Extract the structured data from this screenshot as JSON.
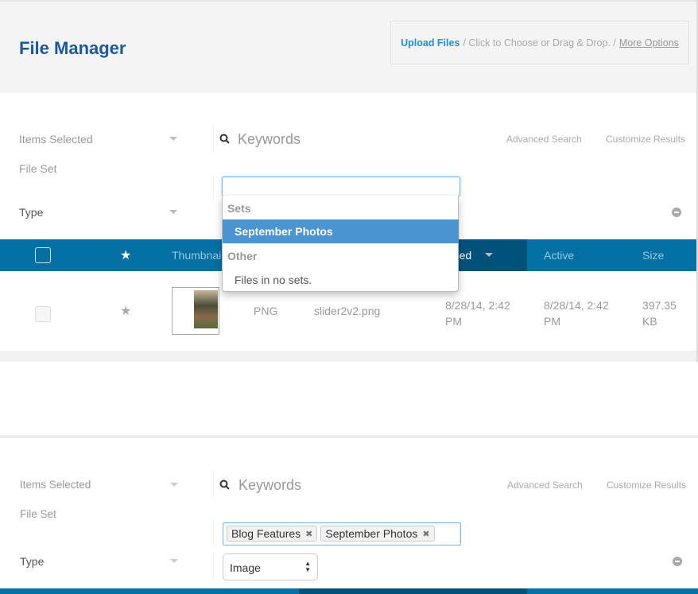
{
  "header": {
    "title": "File Manager",
    "upload": {
      "link": "Upload Files",
      "text": "/ Click to Choose or Drag & Drop. /",
      "more": "More Options"
    }
  },
  "panel1": {
    "filters": {
      "items_selected": "Items Selected",
      "file_set": "File Set",
      "type": "Type"
    },
    "search": {
      "placeholder": "Keywords",
      "advanced": "Advanced Search",
      "customize": "Customize Results"
    },
    "dropdown": {
      "group_sets": "Sets",
      "sets": [
        "September Photos"
      ],
      "group_other": "Other",
      "other": [
        "Files in no sets."
      ],
      "highlighted": "September Photos"
    },
    "columns": {
      "thumbnail": "Thumbnail",
      "date_added": "Date Added",
      "active": "Active",
      "size": "Size"
    },
    "rows": [
      {
        "type": "PNG",
        "name": "slider2v2.png",
        "added": "8/28/14, 2:42 PM",
        "active": "8/28/14, 2:42 PM",
        "size": "397.35 KB"
      }
    ]
  },
  "panel2": {
    "filters": {
      "items_selected": "Items Selected",
      "file_set": "File Set",
      "type": "Type"
    },
    "search": {
      "placeholder": "Keywords",
      "advanced": "Advanced Search",
      "customize": "Customize Results"
    },
    "tags": [
      "Blog Features",
      "September Photos"
    ],
    "type_select": "Image"
  },
  "colors": {
    "brand": "#1b5a9a",
    "table_header": "#0270a3",
    "sorted_header": "#00527b",
    "highlight": "#4a94d0"
  }
}
